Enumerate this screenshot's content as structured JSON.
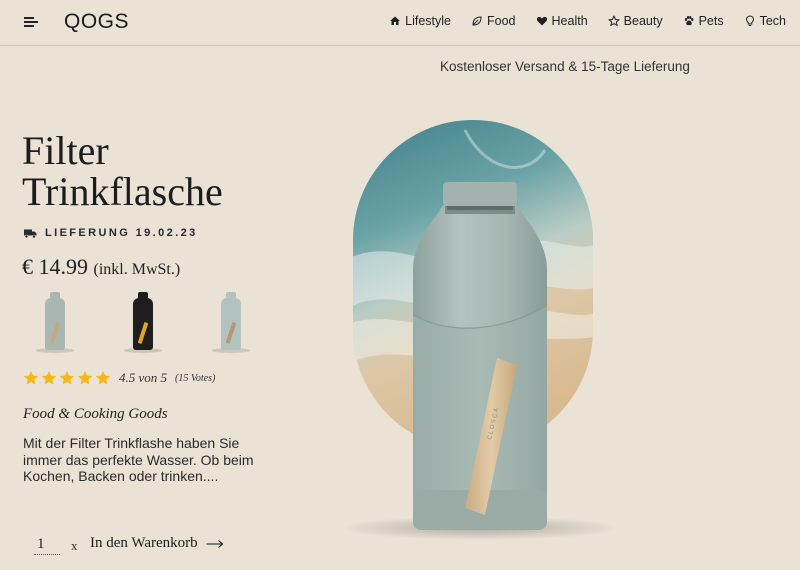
{
  "header": {
    "logo": "QOGS",
    "nav": [
      {
        "label": "Lifestyle",
        "icon": "home-icon"
      },
      {
        "label": "Food",
        "icon": "leaf-icon"
      },
      {
        "label": "Health",
        "icon": "heart-icon"
      },
      {
        "label": "Beauty",
        "icon": "star-outline-icon"
      },
      {
        "label": "Pets",
        "icon": "paw-icon"
      },
      {
        "label": "Tech",
        "icon": "lightbulb-icon"
      }
    ]
  },
  "shipping_note": "Kostenloser Versand & 15-Tage Lieferung",
  "product": {
    "title_line1": "Filter",
    "title_line2": "Trinkflasche",
    "delivery": "LIEFERUNG 19.02.23",
    "price": "€ 14.99",
    "price_tax": "(inkl. MwSt.)",
    "variants": [
      {
        "name": "sage",
        "body_color": "#a9b7b2",
        "strap_color": "#c9a87c"
      },
      {
        "name": "black",
        "body_color": "#1e1e1e",
        "strap_color": "#e0a526"
      },
      {
        "name": "mint",
        "body_color": "#b2c3bf",
        "strap_color": "#b89772"
      }
    ],
    "rating": {
      "stars": 5,
      "star_color": "#f5b719",
      "score_text": "4.5 von 5",
      "votes_text": "(15 Votes)"
    },
    "category": "Food & Cooking Goods",
    "description": "Mit der Filter Trinkflashe haben Sie immer das perfekte Wasser. Ob beim Kochen, Backen oder trinken....",
    "quantity": "1",
    "times": "x",
    "add_to_cart": "In den Warenkorb",
    "bottle_brand": "CLOSCA"
  },
  "colors": {
    "background": "#e9e2d5",
    "bottle": "#a7b8b4",
    "strap": "#d8bf98"
  }
}
